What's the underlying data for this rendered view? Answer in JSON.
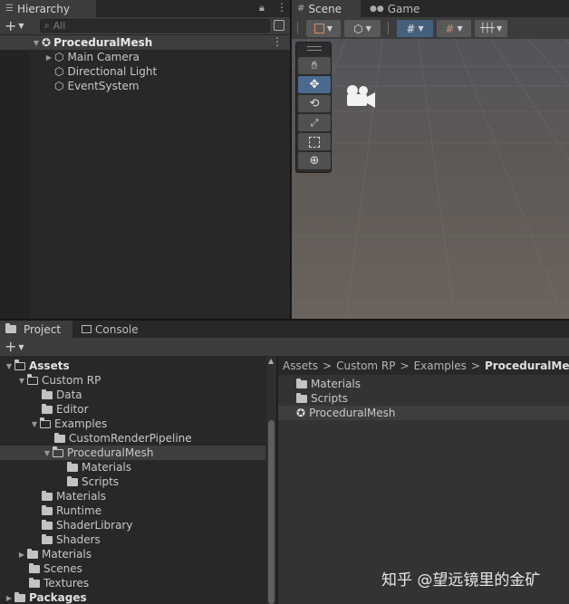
{
  "hierarchy": {
    "tab_label": "Hierarchy",
    "search_placeholder": "All",
    "scene_name": "ProceduralMesh",
    "items": [
      {
        "label": "Main Camera"
      },
      {
        "label": "Directional Light"
      },
      {
        "label": "EventSystem"
      }
    ]
  },
  "scene_view": {
    "tabs": [
      {
        "label": "Scene"
      },
      {
        "label": "Game"
      }
    ]
  },
  "project": {
    "tabs": [
      {
        "label": "Project"
      },
      {
        "label": "Console"
      }
    ],
    "tree": [
      {
        "label": "Assets"
      },
      {
        "label": "Custom RP"
      },
      {
        "label": "Data"
      },
      {
        "label": "Editor"
      },
      {
        "label": "Examples"
      },
      {
        "label": "CustomRenderPipeline"
      },
      {
        "label": "ProceduralMesh"
      },
      {
        "label": "Materials"
      },
      {
        "label": "Scripts"
      },
      {
        "label": "Materials"
      },
      {
        "label": "Runtime"
      },
      {
        "label": "ShaderLibrary"
      },
      {
        "label": "Shaders"
      },
      {
        "label": "Materials"
      },
      {
        "label": "Scenes"
      },
      {
        "label": "Textures"
      },
      {
        "label": "Packages"
      }
    ],
    "breadcrumb": [
      "Assets",
      "Custom RP",
      "Examples",
      "ProceduralMesh"
    ],
    "breadcrumb_sep": ">",
    "content_items": [
      {
        "label": "Materials"
      },
      {
        "label": "Scripts"
      },
      {
        "label": "ProceduralMesh"
      }
    ]
  },
  "watermark": "知乎 @望远镜里的金矿"
}
